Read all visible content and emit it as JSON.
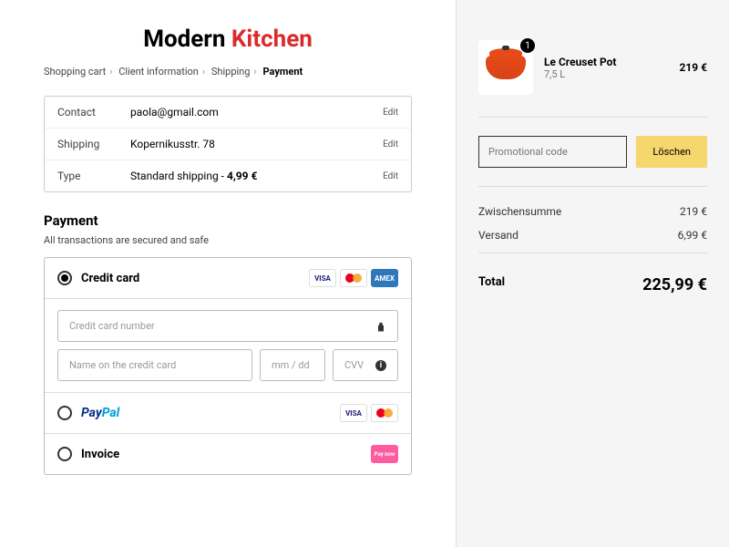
{
  "brand": {
    "word1": "Modern",
    "word2": "Kitchen"
  },
  "crumbs": {
    "a": "Shopping cart",
    "b": "Client information",
    "c": "Shipping",
    "d": "Payment"
  },
  "info": {
    "contact": {
      "label": "Contact",
      "value": "paola@gmail.com",
      "edit": "Edit"
    },
    "shipping": {
      "label": "Shipping",
      "value": "Kopernikusstr. 78",
      "edit": "Edit"
    },
    "type": {
      "label": "Type",
      "prefix": "Standard shipping - ",
      "price": "4,99 €",
      "edit": "Edit"
    }
  },
  "payment": {
    "title": "Payment",
    "subtitle": "All transactions are secured and safe",
    "credit": {
      "label": "Credit card"
    },
    "fields": {
      "number": "Credit card number",
      "name": "Name on the credit card",
      "date": "mm / dd",
      "cvv": "CVV"
    },
    "paypal": {
      "pay": "Pay",
      "pal": "Pal"
    },
    "invoice": {
      "label": "Invoice"
    }
  },
  "icons": {
    "visa": "VISA",
    "amex": "AMEX",
    "paynow": "Pay now"
  },
  "cart": {
    "qty": "1",
    "name": "Le Creuset Pot",
    "sub": "7,5 L",
    "price": "219 €"
  },
  "promo": {
    "placeholder": "Promotional code",
    "button": "Löschen"
  },
  "summary": {
    "subtotal": {
      "label": "Zwischensumme",
      "value": "219 €"
    },
    "shipping": {
      "label": "Versand",
      "value": "6,99 €"
    },
    "total": {
      "label": "Total",
      "value": "225,99 €"
    }
  }
}
